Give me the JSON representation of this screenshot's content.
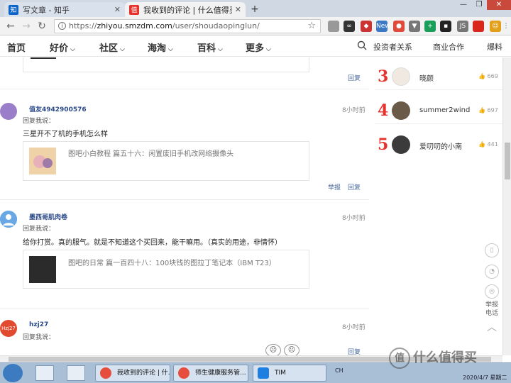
{
  "browser": {
    "tabs": [
      {
        "title": "写文章 - 知乎",
        "favicon": "知",
        "color": "#0a64c9"
      },
      {
        "title": "我收到的评论 | 什么值得买",
        "favicon": "值",
        "color": "#e8312a"
      }
    ],
    "url_scheme": "https://",
    "url_host": "zhiyou.smzdm.com",
    "url_path": "/user/shoudaopinglun/",
    "new_tab_label": "+",
    "window_controls": [
      "—",
      "❐",
      "✕"
    ],
    "extensions": [
      {
        "icon": "share-icon",
        "label": "",
        "color": "#999"
      },
      {
        "icon": "glasses-icon",
        "label": "∞",
        "color": "#333"
      },
      {
        "icon": "cube-icon",
        "label": "◆",
        "color": "#c33"
      },
      {
        "icon": "new-badge-icon",
        "label": "New",
        "color": "#3b79c4"
      },
      {
        "icon": "location-icon",
        "label": "●",
        "color": "#e04a3a"
      },
      {
        "icon": "download-icon",
        "label": "▼",
        "color": "#777"
      },
      {
        "icon": "plus-ext-icon",
        "label": "+",
        "color": "#1a9f5a"
      },
      {
        "icon": "puzzle-icon",
        "label": "▪",
        "color": "#222"
      },
      {
        "icon": "js-icon",
        "label": "JS",
        "color": "#777"
      },
      {
        "icon": "flag-icon",
        "label": "",
        "color": "#d8261b"
      },
      {
        "icon": "emoji-icon",
        "label": "☺",
        "color": "#e39e1a"
      },
      {
        "icon": "menu-icon",
        "label": "⋮",
        "color": "#555"
      }
    ]
  },
  "site_nav": {
    "items": [
      {
        "label": "首页",
        "caret": false
      },
      {
        "label": "好价",
        "caret": true
      },
      {
        "label": "社区",
        "caret": true
      },
      {
        "label": "海淘",
        "caret": true
      },
      {
        "label": "百科",
        "caret": true
      },
      {
        "label": "更多",
        "caret": true
      }
    ],
    "right_items": [
      "投资者关系",
      "商业合作",
      "爆料"
    ]
  },
  "top_reply_label": "回复",
  "comments": [
    {
      "username": "值友4942900576",
      "time": "8小时前",
      "reply_label": "回复我说：",
      "text": "三星开不了机的手机怎么样",
      "ref_text": "图吧小白教程 篇五十六：闲置废旧手机改网络摄像头",
      "actions": [
        "举报",
        "回复"
      ],
      "avatar_color": "#9b7ec9"
    },
    {
      "username": "墨西哥肌肉卷",
      "time": "8小时前",
      "reply_label": "回复我说：",
      "text": "给你打赏。真的服气。就是不知道这个买回来，能干嘛用。（真实的用途，非情怀）",
      "ref_text": "图吧的日常 篇一百四十八：100块钱的图拉丁笔记本（IBM T23）",
      "actions": [
        "回复"
      ],
      "avatar_color": "#69a8e4"
    },
    {
      "username": "hzj27",
      "time": "8小时前",
      "reply_label": "回复我说：",
      "avatar_label": "Hzj27",
      "avatar_color": "#e24a2f"
    }
  ],
  "sidebar_rank": [
    {
      "rank": "3",
      "name": "晓颜",
      "likes": "669"
    },
    {
      "rank": "4",
      "name": "summer2wind",
      "likes": "697"
    },
    {
      "rank": "5",
      "name": "爱叨叨的小南",
      "likes": "441"
    }
  ],
  "float_tool": {
    "items": [
      "phone-icon",
      "wechat-icon",
      "report-icon"
    ],
    "report_label": "举报",
    "report_label2": "电话"
  },
  "taskbar": {
    "tasks": [
      {
        "title": "我收到的评论 | 什..."
      },
      {
        "title": "师生健康服务管..."
      },
      {
        "title": "TIM"
      }
    ],
    "tray_text": "CH",
    "clock_date": "2020/4/7 星期二"
  },
  "watermark": "什么值得买",
  "watermark_logo": "值"
}
